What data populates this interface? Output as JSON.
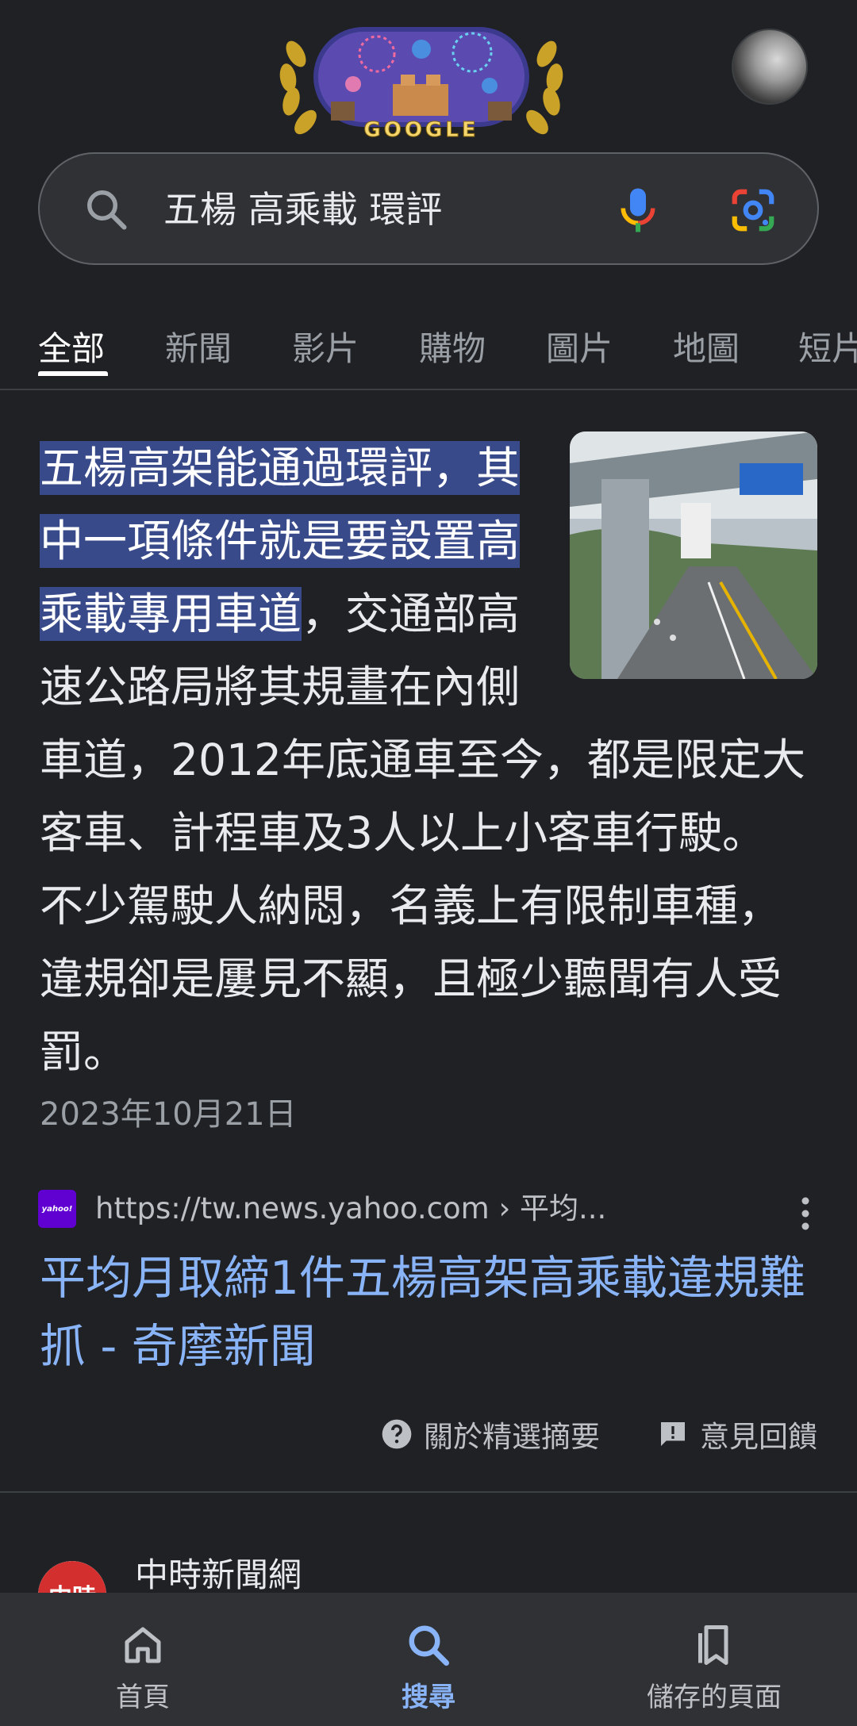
{
  "header": {
    "doodle_text": "GOOGLE"
  },
  "search": {
    "query": "五楊 高乘載 環評"
  },
  "tabs": [
    {
      "label": "全部",
      "active": true
    },
    {
      "label": "新聞",
      "active": false
    },
    {
      "label": "影片",
      "active": false
    },
    {
      "label": "購物",
      "active": false
    },
    {
      "label": "圖片",
      "active": false
    },
    {
      "label": "地圖",
      "active": false
    },
    {
      "label": "短片",
      "active": false
    }
  ],
  "snippet": {
    "highlight_line1": "五楊高架能通過環評，",
    "highlight_line2": "其中一項條件就是要設",
    "highlight_line3": "置高乘載專用車道",
    "rest": "，交通部高速公路局將其規畫在內側車道，2012年底通車至今，都是限定大客車、計程車及3人以上小客車行駛。 不少駕駛人納悶，名義上有限制車種，違規卻是屢見不顯，且極少聽聞有人受罰。",
    "date": "2023年10月21日",
    "source_logo_text": "yahoo!",
    "source_url": "https://tw.news.yahoo.com › 平均...",
    "title": "平均月取締1件五楊高架高乘載違規難抓 - 奇摩新聞",
    "about_label": "關於精選摘要",
    "feedback_label": "意見回饋"
  },
  "next_result": {
    "site": "中時新聞網",
    "logo_text": "中時"
  },
  "bottom_nav": [
    {
      "label": "首頁",
      "icon": "home-icon",
      "active": false
    },
    {
      "label": "搜尋",
      "icon": "search-icon",
      "active": true
    },
    {
      "label": "儲存的頁面",
      "icon": "bookmarks-icon",
      "active": false
    }
  ],
  "colors": {
    "background": "#202124",
    "link": "#8ab4f8",
    "highlight": "#394a8a"
  }
}
